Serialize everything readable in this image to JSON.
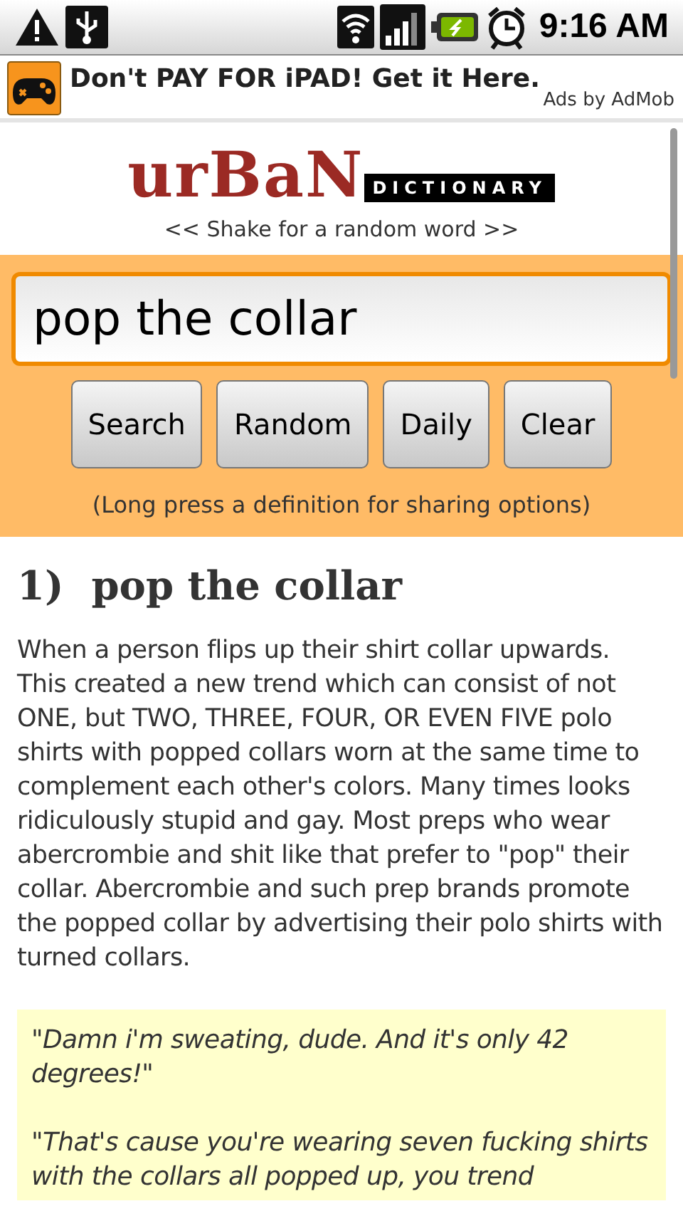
{
  "status_bar": {
    "time": "9:16 AM"
  },
  "ad": {
    "text": "Don't PAY FOR iPAD! Get it Here.",
    "attribution": "Ads by AdMob"
  },
  "logo": {
    "word": "urBaN",
    "banner": "DICTIONARY"
  },
  "shake_hint": "<< Shake for a random word >>",
  "search": {
    "value": "pop the collar"
  },
  "buttons": [
    "Search",
    "Random",
    "Daily",
    "Clear"
  ],
  "sharing_hint": "(Long press a definition for sharing options)",
  "definition": {
    "number": "1)",
    "term": "pop the collar",
    "text": "When a person flips up their shirt collar upwards. This created a new trend which can consist of not ONE, but TWO, THREE, FOUR, OR EVEN FIVE polo shirts with popped collars worn at the same time to complement each other's colors. Many times looks ridiculously stupid and gay. Most preps who wear abercrombie and shit like that prefer to \"pop\" their collar. Abercrombie and such prep brands promote the popped collar by advertising their polo shirts with turned collars.",
    "example": [
      "\"Damn i'm sweating, dude. And it's only 42 degrees!\"",
      "\"That's cause you're wearing seven fucking shirts with the collars all popped up, you trend"
    ]
  }
}
